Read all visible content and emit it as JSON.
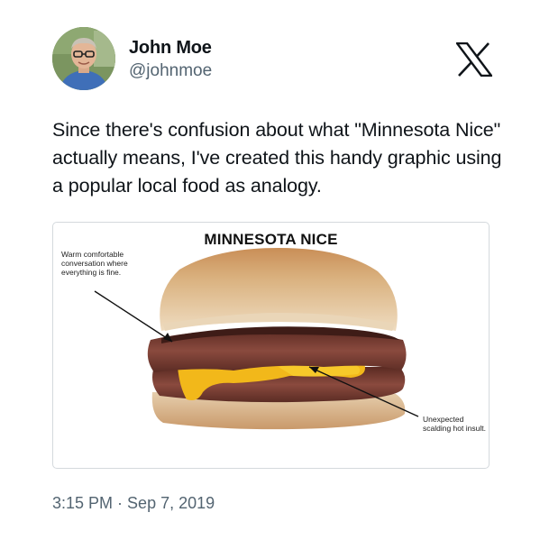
{
  "author": {
    "display_name": "John Moe",
    "handle": "@johnmoe",
    "avatar_icon": "profile-photo"
  },
  "platform": {
    "logo_icon": "x-logo-icon"
  },
  "tweet": {
    "text": "Since there's confusion about what \"Minnesota Nice\" actually means, I've created this handy graphic using a popular local food as analogy."
  },
  "media": {
    "title": "MINNESOTA NICE",
    "annotation_left": "Warm comfortable conversation where everything is fine.",
    "annotation_right": "Unexpected scalding hot insult."
  },
  "meta": {
    "time": "3:15 PM",
    "separator": "·",
    "date": "Sep 7, 2019"
  },
  "colors": {
    "text": "#0f1419",
    "secondary": "#536471",
    "border": "#d4d9dd"
  }
}
